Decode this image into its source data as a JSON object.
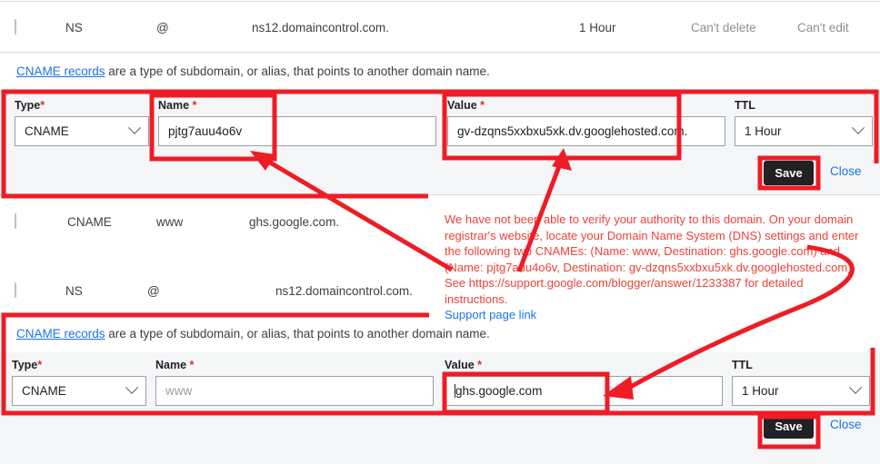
{
  "table": {
    "rows": [
      {
        "checkbox": "unchecked",
        "type": "NS",
        "name": "@",
        "value": "ns12.domaincontrol.com.",
        "ttl": "1 Hour",
        "delete_state": "Can't delete",
        "edit_state": "Can't edit"
      },
      {
        "checkbox": "unchecked",
        "type": "CNAME",
        "name": "www",
        "value": "ghs.google.com.",
        "ttl": "",
        "delete_state": "",
        "edit_state": ""
      },
      {
        "checkbox": "unchecked",
        "type": "NS",
        "name": "@",
        "value": "ns12.domaincontrol.com.",
        "ttl": "",
        "delete_state": "",
        "edit_state": ""
      }
    ]
  },
  "notes": {
    "link_text": "CNAME records",
    "rest_text": " are a type of subdomain, or alias, that points to another domain name."
  },
  "form_top": {
    "type_label": "Type",
    "type_required": "*",
    "type_value": "CNAME",
    "name_label": "Name",
    "name_required": "*",
    "name_value": "pjtg7auu4o6v",
    "value_label": "Value",
    "value_required": "*",
    "value_value": "gv-dzqns5xxbxu5xk.dv.googlehosted.com.",
    "ttl_label": "TTL",
    "ttl_value": "1 Hour",
    "save_label": "Save",
    "close_label": "Close"
  },
  "form_bottom": {
    "type_label": "Type",
    "type_required": "*",
    "type_value": "CNAME",
    "name_label": "Name",
    "name_required": "*",
    "name_value": "www",
    "value_label": "Value",
    "value_required": "*",
    "value_value": "ghs.google.com",
    "ttl_label": "TTL",
    "ttl_value": "1 Hour",
    "save_label": "Save",
    "close_label": "Close"
  },
  "verify_message": {
    "body": "We have not been able to verify your authority to this domain. On your domain registrar's website, locate your Domain Name System (DNS) settings and enter the following two CNAMEs: (Name: www, Destination: ghs.google.com) and (Name: pjtg7auu4o6v, Destination: gv-dzqns5xxbxu5xk.dv.googlehosted.com). See https://support.google.com/blogger/answer/1233387 for detailed instructions.",
    "link_label": "Support page link"
  },
  "colors": {
    "annotation": "#ee1c25",
    "error_text": "#ea4335",
    "link": "#1a73e8",
    "panel_bg": "#f5f6f7",
    "button_bg": "#202124"
  }
}
